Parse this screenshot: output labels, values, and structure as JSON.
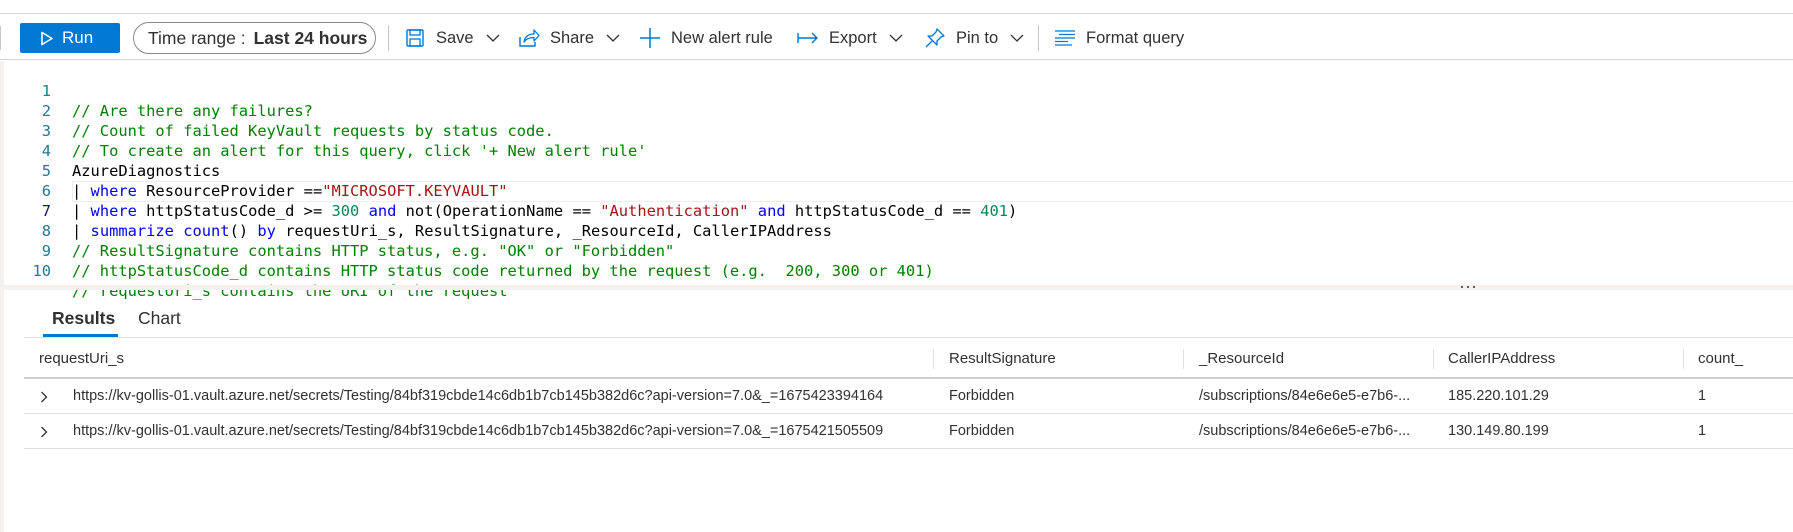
{
  "toolbar": {
    "run_label": "Run",
    "time_range_label": "Time range :",
    "time_range_value": "Last 24 hours",
    "save_label": "Save",
    "share_label": "Share",
    "new_alert_rule_label": "New alert rule",
    "export_label": "Export",
    "pin_to_label": "Pin to",
    "format_query_label": "Format query",
    "accent_color": "#0078d4"
  },
  "editor": {
    "current_line": 7,
    "lines": [
      {
        "number": "1",
        "text": "// Are there any failures?"
      },
      {
        "number": "2",
        "text": "// Count of failed KeyVault requests by status code. "
      },
      {
        "number": "3",
        "text": "// To create an alert for this query, click '+ New alert rule'"
      },
      {
        "number": "4",
        "text": "AzureDiagnostics"
      },
      {
        "number": "5",
        "text": "| where ResourceProvider ==\"MICROSOFT.KEYVAULT\" "
      },
      {
        "number": "6",
        "text": "| where httpStatusCode_d >= 300 and not(OperationName == \"Authentication\" and httpStatusCode_d == 401)"
      },
      {
        "number": "7",
        "text": "| summarize count() by requestUri_s, ResultSignature, _ResourceId, CallerIPAddress"
      },
      {
        "number": "8",
        "text": "// ResultSignature contains HTTP status, e.g. \"OK\" or \"Forbidden\""
      },
      {
        "number": "9",
        "text": "// httpStatusCode_d contains HTTP status code returned by the request (e.g.  200, 300 or 401)"
      },
      {
        "number": "10",
        "text": "// requestUri_s contains the URI of the request"
      }
    ],
    "tokens": {
      "l5_kw": "where",
      "l5_a": " ResourceProvider ==",
      "l5_str": "\"MICROSOFT.KEYVAULT\"",
      "l6_kw1": "where",
      "l6_a": " httpStatusCode_d >= ",
      "l6_num1": "300",
      "l6_kw2": "and",
      "l6_b": " not(OperationName == ",
      "l6_str": "\"Authentication\"",
      "l6_kw3": "and",
      "l6_c": " httpStatusCode_d == ",
      "l6_num2": "401",
      "l6_d": ")",
      "l7_kw1": "summarize",
      "l7_kw2": "count",
      "l7_a": "() ",
      "l7_kw3": "by",
      "l7_b": " requestUri_s, ResultSignature, _ResourceId, CallerIPAddress"
    }
  },
  "results": {
    "tabs": [
      {
        "label": "Results",
        "selected": true
      },
      {
        "label": "Chart",
        "selected": false
      }
    ],
    "columns": [
      "requestUri_s",
      "ResultSignature",
      "_ResourceId",
      "CallerIPAddress",
      "count_"
    ],
    "rows": [
      {
        "requestUri_s": "https://kv-gollis-01.vault.azure.net/secrets/Testing/84bf319cbde14c6db1b7cb145b382d6c?api-version=7.0&_=1675423394164",
        "ResultSignature": "Forbidden",
        "_ResourceId": "/subscriptions/84e6e6e5-e7b6-...",
        "CallerIPAddress": "185.220.101.29",
        "count_": "1"
      },
      {
        "requestUri_s": "https://kv-gollis-01.vault.azure.net/secrets/Testing/84bf319cbde14c6db1b7cb145b382d6c?api-version=7.0&_=1675421505509",
        "ResultSignature": "Forbidden",
        "_ResourceId": "/subscriptions/84e6e6e5-e7b6-...",
        "CallerIPAddress": "130.149.80.199",
        "count_": "1"
      }
    ]
  }
}
